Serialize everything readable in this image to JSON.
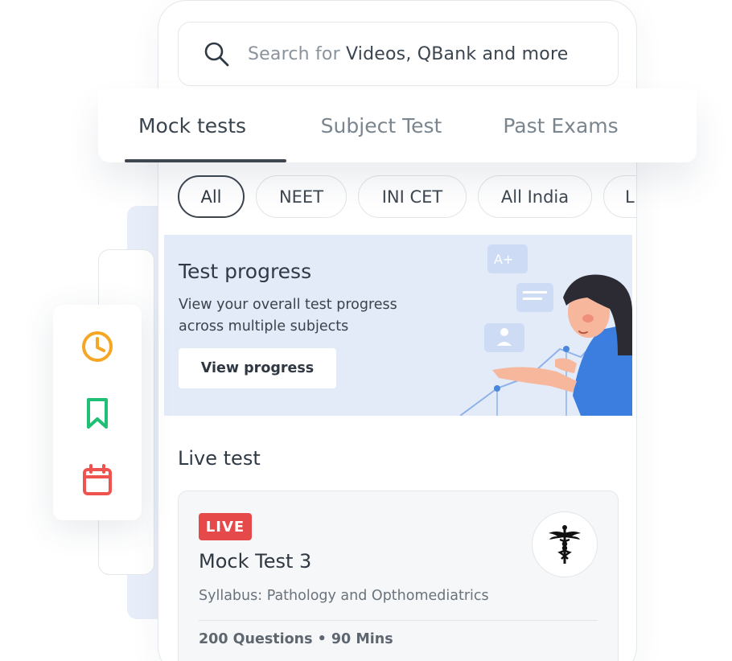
{
  "search": {
    "prefix": "Search for",
    "highlight": "Videos, QBank and more"
  },
  "tabs": [
    {
      "label": "Mock tests",
      "active": true
    },
    {
      "label": "Subject Test",
      "active": false
    },
    {
      "label": "Past Exams",
      "active": false
    }
  ],
  "filters": [
    {
      "label": "All",
      "active": true
    },
    {
      "label": "NEET",
      "active": false
    },
    {
      "label": "INI CET",
      "active": false
    },
    {
      "label": "All India",
      "active": false
    },
    {
      "label": "L",
      "active": false
    }
  ],
  "progress_banner": {
    "title": "Test progress",
    "description": "View your overall test progress across multiple subjects",
    "button_label": "View progress",
    "illustration_grade": "A+"
  },
  "live_section": {
    "title": "Live test",
    "card": {
      "badge": "LIVE",
      "title": "Mock Test 3",
      "syllabus": "Syllabus: Pathology and Opthomediatrics",
      "meta": "200 Questions • 90 Mins",
      "logo_icon": "caduceus-icon"
    }
  },
  "side_panel": {
    "icons": [
      {
        "name": "clock-icon",
        "color": "#f5a623"
      },
      {
        "name": "bookmark-icon",
        "color": "#1fbf75"
      },
      {
        "name": "calendar-icon",
        "color": "#ef5350"
      }
    ]
  },
  "colors": {
    "banner_bg": "#e3ebf9",
    "live_red": "#e64949",
    "accent_blue": "#3a7bd5"
  }
}
